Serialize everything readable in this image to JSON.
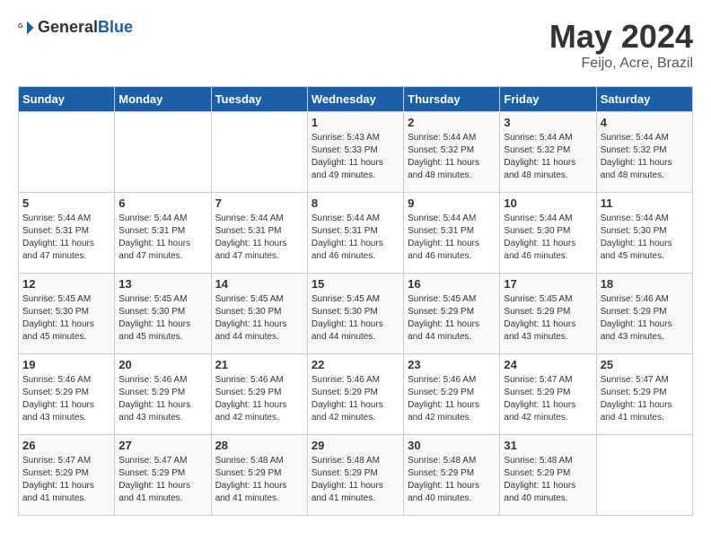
{
  "header": {
    "logo_general": "General",
    "logo_blue": "Blue",
    "main_title": "May 2024",
    "subtitle": "Feijo, Acre, Brazil"
  },
  "calendar": {
    "days_of_week": [
      "Sunday",
      "Monday",
      "Tuesday",
      "Wednesday",
      "Thursday",
      "Friday",
      "Saturday"
    ],
    "weeks": [
      [
        {
          "day": "",
          "info": ""
        },
        {
          "day": "",
          "info": ""
        },
        {
          "day": "",
          "info": ""
        },
        {
          "day": "1",
          "info": "Sunrise: 5:43 AM\nSunset: 5:33 PM\nDaylight: 11 hours\nand 49 minutes."
        },
        {
          "day": "2",
          "info": "Sunrise: 5:44 AM\nSunset: 5:32 PM\nDaylight: 11 hours\nand 48 minutes."
        },
        {
          "day": "3",
          "info": "Sunrise: 5:44 AM\nSunset: 5:32 PM\nDaylight: 11 hours\nand 48 minutes."
        },
        {
          "day": "4",
          "info": "Sunrise: 5:44 AM\nSunset: 5:32 PM\nDaylight: 11 hours\nand 48 minutes."
        }
      ],
      [
        {
          "day": "5",
          "info": "Sunrise: 5:44 AM\nSunset: 5:31 PM\nDaylight: 11 hours\nand 47 minutes."
        },
        {
          "day": "6",
          "info": "Sunrise: 5:44 AM\nSunset: 5:31 PM\nDaylight: 11 hours\nand 47 minutes."
        },
        {
          "day": "7",
          "info": "Sunrise: 5:44 AM\nSunset: 5:31 PM\nDaylight: 11 hours\nand 47 minutes."
        },
        {
          "day": "8",
          "info": "Sunrise: 5:44 AM\nSunset: 5:31 PM\nDaylight: 11 hours\nand 46 minutes."
        },
        {
          "day": "9",
          "info": "Sunrise: 5:44 AM\nSunset: 5:31 PM\nDaylight: 11 hours\nand 46 minutes."
        },
        {
          "day": "10",
          "info": "Sunrise: 5:44 AM\nSunset: 5:30 PM\nDaylight: 11 hours\nand 46 minutes."
        },
        {
          "day": "11",
          "info": "Sunrise: 5:44 AM\nSunset: 5:30 PM\nDaylight: 11 hours\nand 45 minutes."
        }
      ],
      [
        {
          "day": "12",
          "info": "Sunrise: 5:45 AM\nSunset: 5:30 PM\nDaylight: 11 hours\nand 45 minutes."
        },
        {
          "day": "13",
          "info": "Sunrise: 5:45 AM\nSunset: 5:30 PM\nDaylight: 11 hours\nand 45 minutes."
        },
        {
          "day": "14",
          "info": "Sunrise: 5:45 AM\nSunset: 5:30 PM\nDaylight: 11 hours\nand 44 minutes."
        },
        {
          "day": "15",
          "info": "Sunrise: 5:45 AM\nSunset: 5:30 PM\nDaylight: 11 hours\nand 44 minutes."
        },
        {
          "day": "16",
          "info": "Sunrise: 5:45 AM\nSunset: 5:29 PM\nDaylight: 11 hours\nand 44 minutes."
        },
        {
          "day": "17",
          "info": "Sunrise: 5:45 AM\nSunset: 5:29 PM\nDaylight: 11 hours\nand 43 minutes."
        },
        {
          "day": "18",
          "info": "Sunrise: 5:46 AM\nSunset: 5:29 PM\nDaylight: 11 hours\nand 43 minutes."
        }
      ],
      [
        {
          "day": "19",
          "info": "Sunrise: 5:46 AM\nSunset: 5:29 PM\nDaylight: 11 hours\nand 43 minutes."
        },
        {
          "day": "20",
          "info": "Sunrise: 5:46 AM\nSunset: 5:29 PM\nDaylight: 11 hours\nand 43 minutes."
        },
        {
          "day": "21",
          "info": "Sunrise: 5:46 AM\nSunset: 5:29 PM\nDaylight: 11 hours\nand 42 minutes."
        },
        {
          "day": "22",
          "info": "Sunrise: 5:46 AM\nSunset: 5:29 PM\nDaylight: 11 hours\nand 42 minutes."
        },
        {
          "day": "23",
          "info": "Sunrise: 5:46 AM\nSunset: 5:29 PM\nDaylight: 11 hours\nand 42 minutes."
        },
        {
          "day": "24",
          "info": "Sunrise: 5:47 AM\nSunset: 5:29 PM\nDaylight: 11 hours\nand 42 minutes."
        },
        {
          "day": "25",
          "info": "Sunrise: 5:47 AM\nSunset: 5:29 PM\nDaylight: 11 hours\nand 41 minutes."
        }
      ],
      [
        {
          "day": "26",
          "info": "Sunrise: 5:47 AM\nSunset: 5:29 PM\nDaylight: 11 hours\nand 41 minutes."
        },
        {
          "day": "27",
          "info": "Sunrise: 5:47 AM\nSunset: 5:29 PM\nDaylight: 11 hours\nand 41 minutes."
        },
        {
          "day": "28",
          "info": "Sunrise: 5:48 AM\nSunset: 5:29 PM\nDaylight: 11 hours\nand 41 minutes."
        },
        {
          "day": "29",
          "info": "Sunrise: 5:48 AM\nSunset: 5:29 PM\nDaylight: 11 hours\nand 41 minutes."
        },
        {
          "day": "30",
          "info": "Sunrise: 5:48 AM\nSunset: 5:29 PM\nDaylight: 11 hours\nand 40 minutes."
        },
        {
          "day": "31",
          "info": "Sunrise: 5:48 AM\nSunset: 5:29 PM\nDaylight: 11 hours\nand 40 minutes."
        },
        {
          "day": "",
          "info": ""
        }
      ]
    ]
  }
}
